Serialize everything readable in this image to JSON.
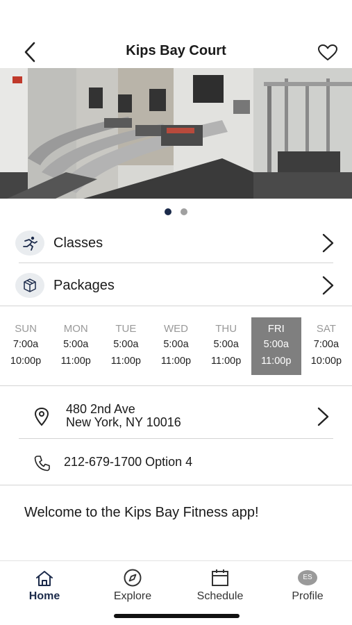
{
  "header": {
    "title": "Kips Bay Court",
    "back_icon": "chevron-left-icon",
    "favorite_icon": "heart-outline-icon"
  },
  "hero": {
    "image": "treadmills-photo",
    "pages": 2,
    "current_page": 1
  },
  "menu": [
    {
      "label": "Classes",
      "icon": "running-person-icon"
    },
    {
      "label": "Packages",
      "icon": "package-box-icon"
    }
  ],
  "hours": [
    {
      "day": "SUN",
      "open": "7:00a",
      "close": "10:00p",
      "active": false
    },
    {
      "day": "MON",
      "open": "5:00a",
      "close": "11:00p",
      "active": false
    },
    {
      "day": "TUE",
      "open": "5:00a",
      "close": "11:00p",
      "active": false
    },
    {
      "day": "WED",
      "open": "5:00a",
      "close": "11:00p",
      "active": false
    },
    {
      "day": "THU",
      "open": "5:00a",
      "close": "11:00p",
      "active": false
    },
    {
      "day": "FRI",
      "open": "5:00a",
      "close": "11:00p",
      "active": true
    },
    {
      "day": "SAT",
      "open": "7:00a",
      "close": "10:00p",
      "active": false
    }
  ],
  "address": {
    "line1": "480 2nd Ave",
    "line2": "New York, NY 10016",
    "icon": "location-pin-icon"
  },
  "phone": {
    "text": "212-679-1700 Option 4",
    "icon": "phone-icon"
  },
  "welcome": "Welcome to the Kips Bay Fitness app!",
  "tabs": [
    {
      "label": "Home",
      "icon": "home-icon",
      "active": true
    },
    {
      "label": "Explore",
      "icon": "compass-icon",
      "active": false
    },
    {
      "label": "Schedule",
      "icon": "calendar-icon",
      "active": false
    },
    {
      "label": "Profile",
      "icon": "avatar-icon",
      "avatar_initials": "ES",
      "active": false
    }
  ],
  "colors": {
    "active_day_bg": "#7f7f7f",
    "active_tab": "#1b2a4a",
    "icon_circle_bg": "#e9ecef",
    "dot_active": "#1b2a4a",
    "dot_inactive": "#a0a0a0"
  }
}
